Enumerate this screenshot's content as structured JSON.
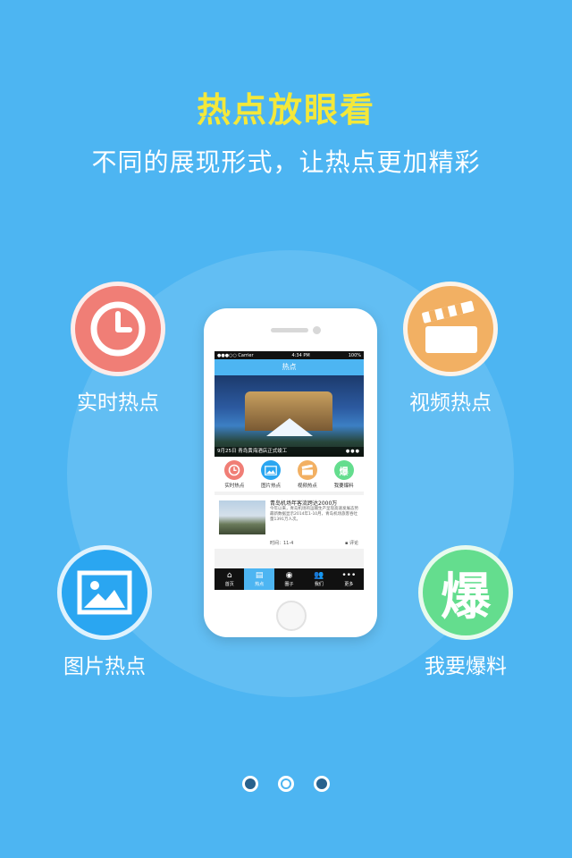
{
  "title": "热点放眼看",
  "subtitle": "不同的展现形式，让热点更加精彩",
  "features": {
    "realtime": {
      "label": "实时热点",
      "icon": "clock-icon",
      "color": "#f07e76"
    },
    "video": {
      "label": "视频热点",
      "icon": "clapperboard-icon",
      "color": "#f2b063"
    },
    "picture": {
      "label": "图片热点",
      "icon": "image-icon",
      "color": "#2aa6f1"
    },
    "scoop": {
      "label": "我要爆料",
      "icon": "bao-icon",
      "icon_text": "爆",
      "color": "#64dd8e"
    }
  },
  "phone": {
    "status": {
      "carrier": "●●●○○ Carrier",
      "time": "4:34 PM",
      "battery": "100%"
    },
    "nav_title": "热点",
    "banner_caption": "9月25日 青岛黄海酒店正式竣工",
    "banner_dots": "●●●",
    "quick_items": [
      {
        "label": "实时热点",
        "color": "#f07e76"
      },
      {
        "label": "图片热点",
        "color": "#2aa6f1"
      },
      {
        "label": "视频热点",
        "color": "#f2b063"
      },
      {
        "label": "我要爆料",
        "color": "#64dd8e",
        "text": "爆"
      }
    ],
    "news": {
      "title": "青岛机场年客流跨达2000万",
      "body": "今年以来，青岛机场的运输生产呈现高速发展态势最新数据显示2014年1-10月，青岛机场旅客吞吐量1391万人次。",
      "time": "时间：11-4",
      "comment": "评论"
    },
    "tabs": [
      {
        "label": "首页",
        "icon": "⌂"
      },
      {
        "label": "热点",
        "icon": "▤"
      },
      {
        "label": "圈子",
        "icon": "◉"
      },
      {
        "label": "我们",
        "icon": "👥"
      },
      {
        "label": "更多",
        "icon": "•••"
      }
    ]
  },
  "pager": {
    "count": 3,
    "active": 2
  }
}
